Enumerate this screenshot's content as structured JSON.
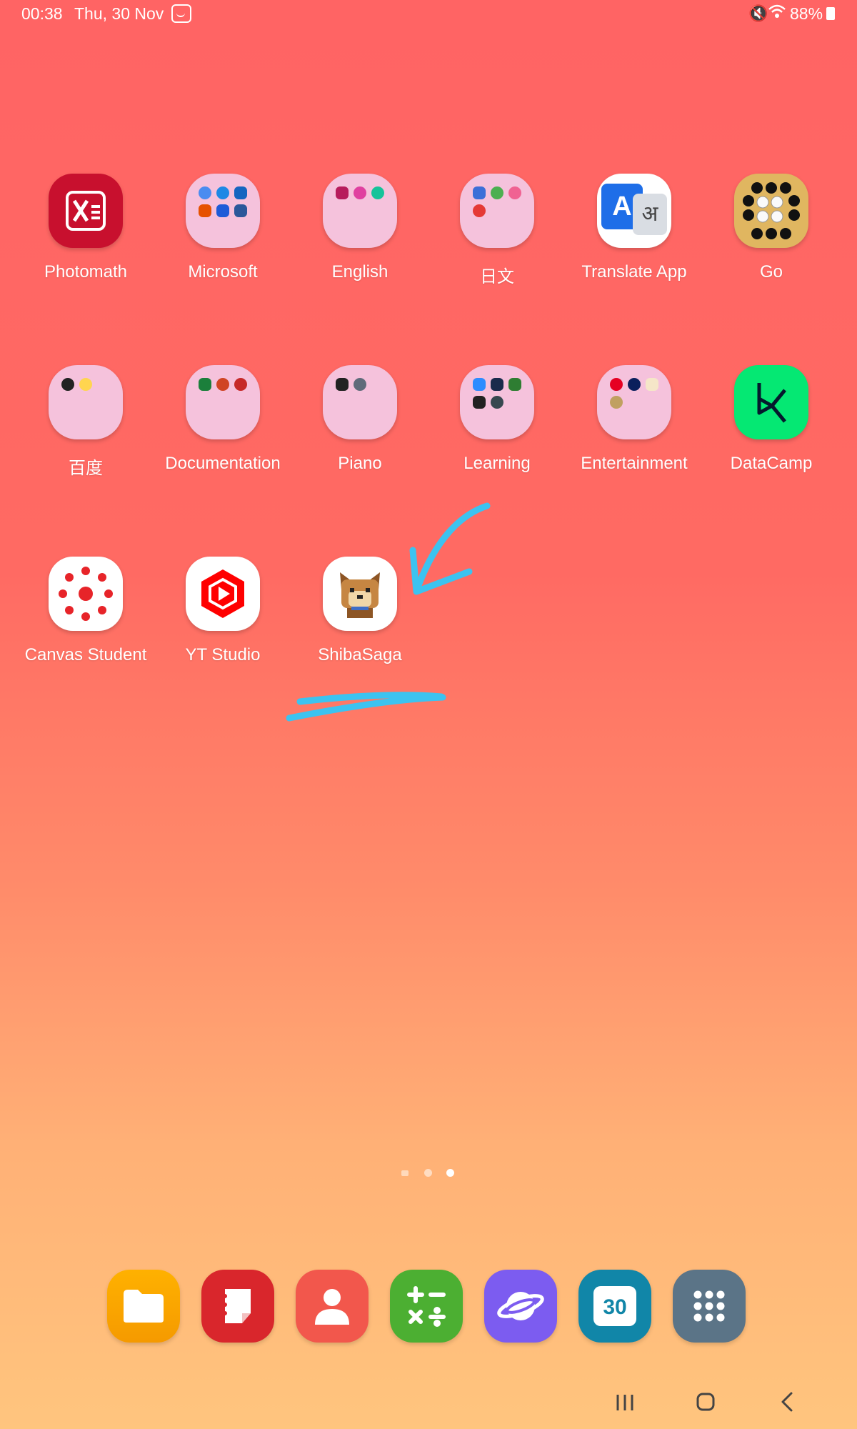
{
  "status_bar": {
    "time": "00:38",
    "date": "Thu, 30 Nov",
    "battery": "88%",
    "icons": [
      "notification-icon",
      "mute-icon",
      "wifi-icon",
      "battery-icon"
    ]
  },
  "apps": [
    {
      "label": "Photomath"
    },
    {
      "label": "Microsoft"
    },
    {
      "label": "English"
    },
    {
      "label": "日文"
    },
    {
      "label": "Translate App"
    },
    {
      "label": "Go"
    },
    {
      "label": "百度"
    },
    {
      "label": "Documentation"
    },
    {
      "label": "Piano"
    },
    {
      "label": "Learning"
    },
    {
      "label": "Entertainment"
    },
    {
      "label": "DataCamp"
    },
    {
      "label": "Canvas Student"
    },
    {
      "label": "YT Studio"
    },
    {
      "label": "ShibaSaga"
    }
  ],
  "icon_text": {
    "translate_a": "A",
    "translate_b": "अ",
    "calendar_day": "30"
  },
  "dock": [
    "my-files-icon",
    "notes-icon",
    "contacts-icon",
    "calculator-icon",
    "internet-browser-icon",
    "calendar-icon",
    "app-drawer-icon"
  ],
  "page_indicator": {
    "pages": 3,
    "current": 3
  },
  "colors": {
    "background_top": "#ff6464",
    "background_bottom": "#ffc57e",
    "annotation": "#3cc3f0",
    "folder": "#f5c2dc"
  }
}
